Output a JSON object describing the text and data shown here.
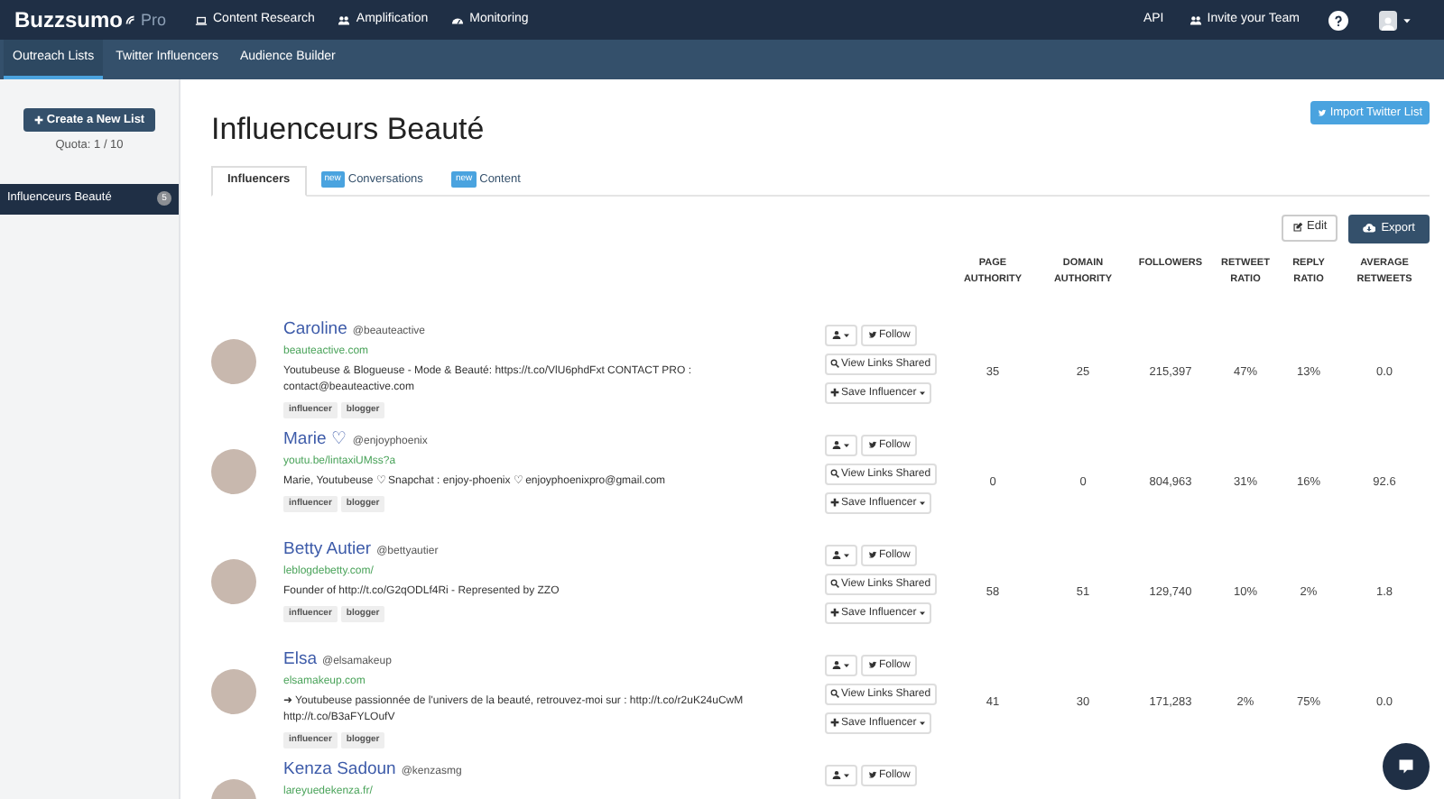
{
  "brand": {
    "name": "Buzzsumo",
    "edition": "Pro"
  },
  "top_nav": [
    {
      "label": "Content Research"
    },
    {
      "label": "Amplification"
    },
    {
      "label": "Monitoring"
    }
  ],
  "top_right": {
    "api": "API",
    "invite": "Invite your Team"
  },
  "sub_nav": [
    {
      "label": "Outreach Lists",
      "selected": true
    },
    {
      "label": "Twitter Influencers",
      "selected": false
    },
    {
      "label": "Audience Builder",
      "selected": false
    }
  ],
  "sidebar": {
    "create_button": "Create a New List",
    "quota": "Quota: 1 / 10",
    "lists": [
      {
        "label": "Influenceurs Beauté",
        "count": "5",
        "selected": true
      }
    ]
  },
  "page": {
    "title": "Influenceurs Beauté",
    "import_button": "Import Twitter List",
    "edit_button": "Edit",
    "export_button": "Export"
  },
  "tabs": [
    {
      "label": "Influencers",
      "selected": true
    },
    {
      "label": "Conversations",
      "badge": "new",
      "selected": false
    },
    {
      "label": "Content",
      "badge": "new",
      "selected": false
    }
  ],
  "table": {
    "columns": [
      "PAGE AUTHORITY",
      "DOMAIN AUTHORITY",
      "FOLLOWERS",
      "RETWEET RATIO",
      "REPLY RATIO",
      "AVERAGE RETWEETS"
    ],
    "rows": [
      {
        "name": "Caroline",
        "handle": "@beauteactive",
        "website": "beauteactive.com",
        "bio": "Youtubeuse & Blogueuse - Mode & Beauté: https://t.co/VlU6phdFxt CONTACT PRO : contact@beauteactive.com",
        "tags": [
          "influencer",
          "blogger"
        ],
        "actions": {
          "follow": "Follow",
          "view_links": "View Links Shared",
          "save": "Save Influencer"
        },
        "stats": [
          "35",
          "25",
          "215,397",
          "47%",
          "13%",
          "0.0"
        ]
      },
      {
        "name": "Marie ♡",
        "handle": "@enjoyphoenix",
        "website": "youtu.be/lintaxiUMss?a",
        "bio": "Marie, Youtubeuse ♡ Snapchat : enjoy-phoenix ♡ enjoyphoenixpro@gmail.com",
        "tags": [
          "influencer",
          "blogger"
        ],
        "actions": {
          "follow": "Follow",
          "view_links": "View Links Shared",
          "save": "Save Influencer"
        },
        "stats": [
          "0",
          "0",
          "804,963",
          "31%",
          "16%",
          "92.6"
        ]
      },
      {
        "name": "Betty Autier",
        "handle": "@bettyautier",
        "website": "leblogdebetty.com/",
        "bio": "Founder of http://t.co/G2qODLf4Ri - Represented by ZZO",
        "tags": [
          "influencer",
          "blogger"
        ],
        "actions": {
          "follow": "Follow",
          "view_links": "View Links Shared",
          "save": "Save Influencer"
        },
        "stats": [
          "58",
          "51",
          "129,740",
          "10%",
          "2%",
          "1.8"
        ]
      },
      {
        "name": "Elsa",
        "handle": "@elsamakeup",
        "website": "elsamakeup.com",
        "bio": "➜ Youtubeuse passionnée de l'univers de la beauté, retrouvez-moi sur : http://t.co/r2uK24uCwM http://t.co/B3aFYLOufV",
        "tags": [
          "influencer",
          "blogger"
        ],
        "actions": {
          "follow": "Follow",
          "view_links": "View Links Shared",
          "save": "Save Influencer"
        },
        "stats": [
          "41",
          "30",
          "171,283",
          "2%",
          "75%",
          "0.0"
        ]
      },
      {
        "name": "Kenza Sadoun",
        "handle": "@kenzasmg",
        "website": "lareyuedekenza.fr/",
        "tags": [],
        "actions": {
          "follow": "Follow"
        },
        "stats": []
      }
    ]
  }
}
